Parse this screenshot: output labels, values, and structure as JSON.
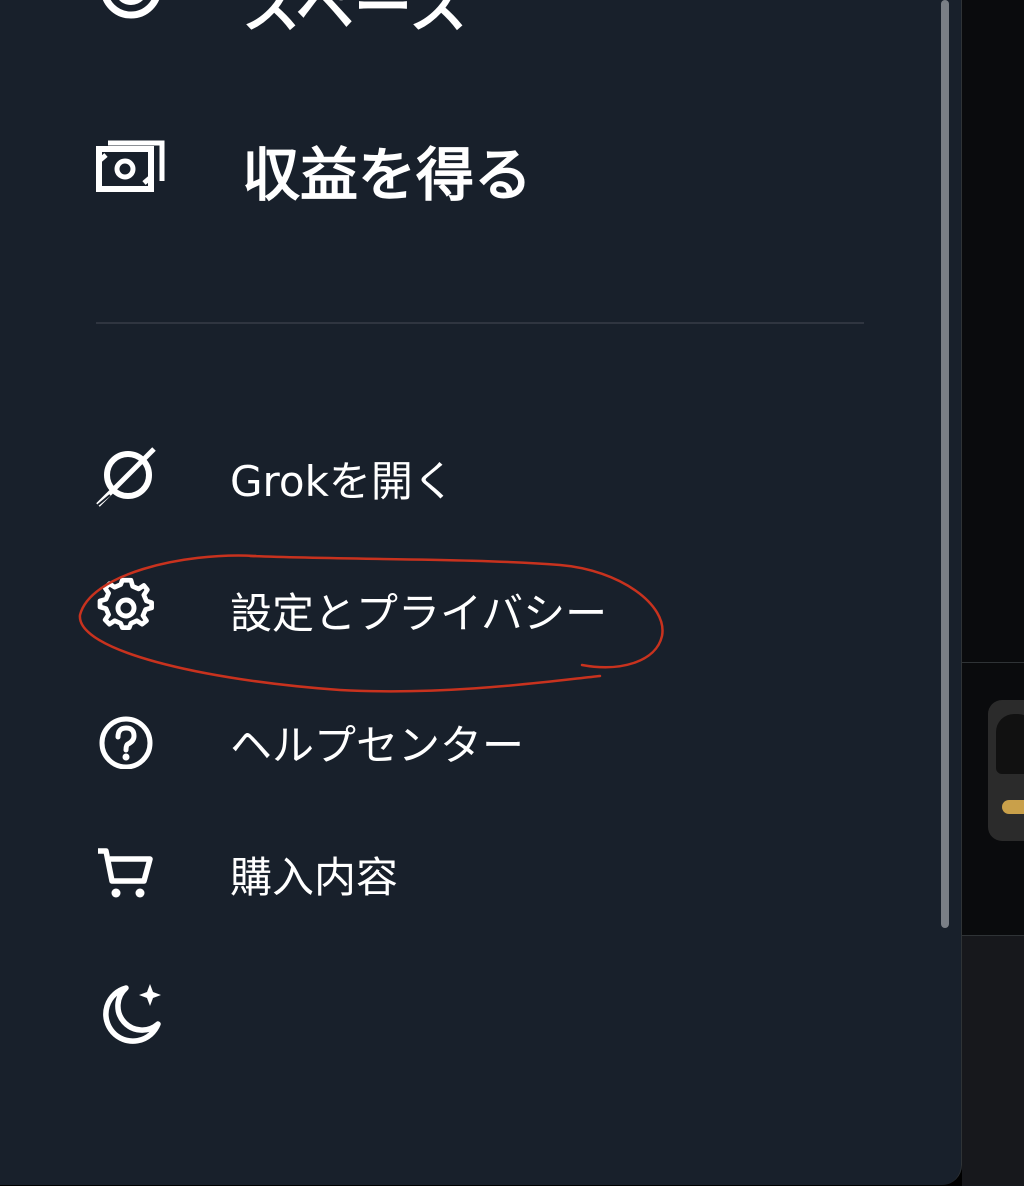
{
  "drawer": {
    "items_top": [
      {
        "label": "スペース",
        "icon": "spaces-icon"
      },
      {
        "label": "収益を得る",
        "icon": "money-icon"
      }
    ],
    "items_bottom": [
      {
        "label": "Grokを開く",
        "icon": "grok-icon"
      },
      {
        "label": "設定とプライバシー",
        "icon": "gear-icon"
      },
      {
        "label": "ヘルプセンター",
        "icon": "help-icon"
      },
      {
        "label": "購入内容",
        "icon": "cart-icon"
      }
    ],
    "display_toggle": {
      "icon": "moon-sparkle-icon"
    }
  },
  "colors": {
    "drawer_bg": "#18202b",
    "text": "#ffffff",
    "annotation": "#c8321e"
  }
}
